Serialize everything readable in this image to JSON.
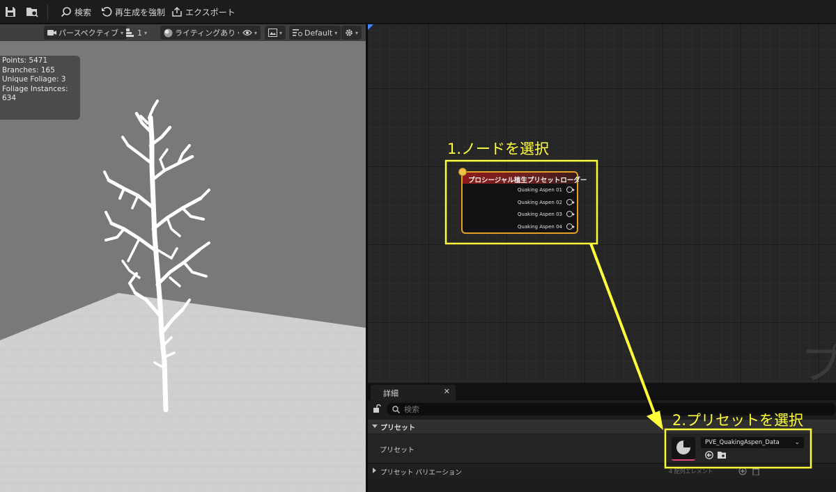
{
  "toolbar": {
    "search_label": "検索",
    "regenerate_label": "再生成を強制",
    "export_label": "エクスポート"
  },
  "viewport": {
    "view_mode": "パースペクティブ",
    "lod_value": "1",
    "lighting_mode": "ライティングあり",
    "profile": "Default",
    "stats": {
      "points": "Points: 5471",
      "branches": "Branches: 165",
      "unique_foliage": "Unique Foliage: 3",
      "foliage_instances": "Foliage Instances: 634"
    }
  },
  "graph": {
    "node": {
      "title": "プロシージャル植生プリセットローダー",
      "outputs": [
        "Quaking Aspen 01",
        "Quaking Aspen 02",
        "Quaking Aspen 03",
        "Quaking Aspen 04"
      ]
    },
    "watermark": "プ"
  },
  "details": {
    "tab_label": "詳細",
    "close_glyph": "✕",
    "search_placeholder": "検索",
    "category": "プリセット",
    "preset_label": "プリセット",
    "preset_value": "PVE_QuakingAspen_Data",
    "variation_label": "プリセット バリエーション",
    "variation_count": "4 配列エレメント"
  },
  "annotations": {
    "step1": "1.ノードを選択",
    "step2": "2.プリセットを選択",
    "color": "#ffff3a"
  },
  "colors": {
    "node_border": "#e6a022",
    "node_header": "#8b1b1b",
    "thumbnail_underline": "#e0457b",
    "graph_corner": "#3f86ff"
  }
}
